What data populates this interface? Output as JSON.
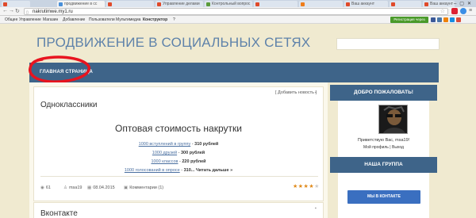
{
  "browser": {
    "tabs": [
      "",
      "продвижение в сс",
      "",
      "Управление делами",
      "Контрольный вопрос",
      "",
      "",
      "Ваш аккаунт",
      "",
      "Ваш аккаунт"
    ],
    "url": "nakrutimwe.my1.ru"
  },
  "adminbar": {
    "items": [
      "Общее",
      "Управление",
      "Магазин",
      "Добавление",
      "Пользователи",
      "Мультимедиа",
      "Конструктор",
      "?"
    ],
    "register_label": "Регистрация через"
  },
  "site": {
    "title": "ПРОДВИЖЕНИЕ В СОЦИАЛЬНЫХ СЕТЯХ",
    "nav": {
      "home": "ГЛАВНАЯ СТРАНИЦА"
    }
  },
  "post": {
    "title": "Одноклассники",
    "add_news": "[ Добавить новость ]",
    "heading": "Оптовая стоимость накрутки",
    "prices": [
      {
        "link": "1000 вступлений в группу",
        "value": "310 рублей"
      },
      {
        "link": "1000 друзей",
        "value": "300 рублей"
      },
      {
        "link": "1000 классов",
        "value": "220 рублей"
      },
      {
        "link": "1000 голосований в опросе",
        "value": "310... Читать дальше »"
      }
    ],
    "meta": {
      "views": "61",
      "author": "msa19",
      "date": "08.04.2015",
      "comments": "Комментарии (1)"
    },
    "rating": 4
  },
  "post2": {
    "title": "Вконтакте"
  },
  "sidebar": {
    "welcome_head": "ДОБРО ПОЖАЛОВАТЬ!",
    "greeting_prefix": "Приветствую Вас,",
    "username": "msa19",
    "greeting_suffix": "!",
    "profile_link": "Мой профиль",
    "separator": "|",
    "logout_link": "Выход",
    "group_head": "НАША ГРУППА",
    "vk_button": "МЫ В КОНТАКТЕ"
  },
  "colors": {
    "page_bg": "#f0ead0",
    "nav_bg": "#3e6489",
    "title": "#5e82aa",
    "vk_button": "#3a6fc0"
  }
}
